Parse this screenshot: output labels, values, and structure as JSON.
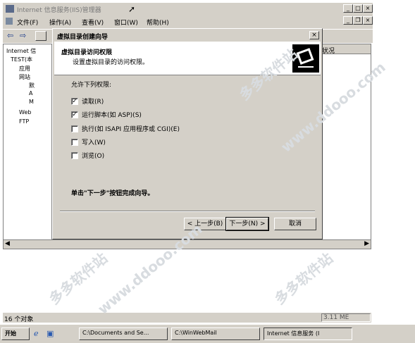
{
  "window": {
    "title": "Internet 信息服务(IIS)管理器",
    "min": "_",
    "max": "□",
    "close": "×",
    "inner_min": "_",
    "inner_restore": "❐",
    "inner_close": "×"
  },
  "menu": {
    "items": [
      "文件(F)",
      "操作(A)",
      "查看(V)",
      "窗口(W)",
      "帮助(H)"
    ]
  },
  "tree": {
    "rows": [
      "Internet 信",
      "TEST(本",
      "应用",
      "网站",
      "默",
      "A",
      "M",
      "Web",
      "FTP"
    ]
  },
  "right_header": "状况",
  "status": {
    "objects": "16 个对象",
    "version": "3.11 ME"
  },
  "taskbar": {
    "start": "开始",
    "tasks": [
      "C:\\Documents and Se...",
      "C:\\WinWebMail",
      "Internet 信息服务 (I"
    ]
  },
  "dialog": {
    "title": "虚拟目录创建向导",
    "close": "×",
    "header_title": "虚拟目录访问权限",
    "header_subtitle": "设置虚拟目录的访问权限。",
    "perm_label": "允许下列权限:",
    "permissions": [
      {
        "label": "读取(R)",
        "checked": true
      },
      {
        "label": "运行脚本(如 ASP)(S)",
        "checked": true
      },
      {
        "label": "执行(如 ISAPI 应用程序或 CGI)(E)",
        "checked": false
      },
      {
        "label": "写入(W)",
        "checked": false
      },
      {
        "label": "浏览(O)",
        "checked": false
      }
    ],
    "check_mark": "✓",
    "finish_note": "单击\"下一步\"按钮完成向导。",
    "back_button": "< 上一步(B)",
    "next_button": "下一步(N) >",
    "cancel_button": "取消"
  },
  "watermark": [
    "多多软件站",
    "www.ddooo.com"
  ]
}
